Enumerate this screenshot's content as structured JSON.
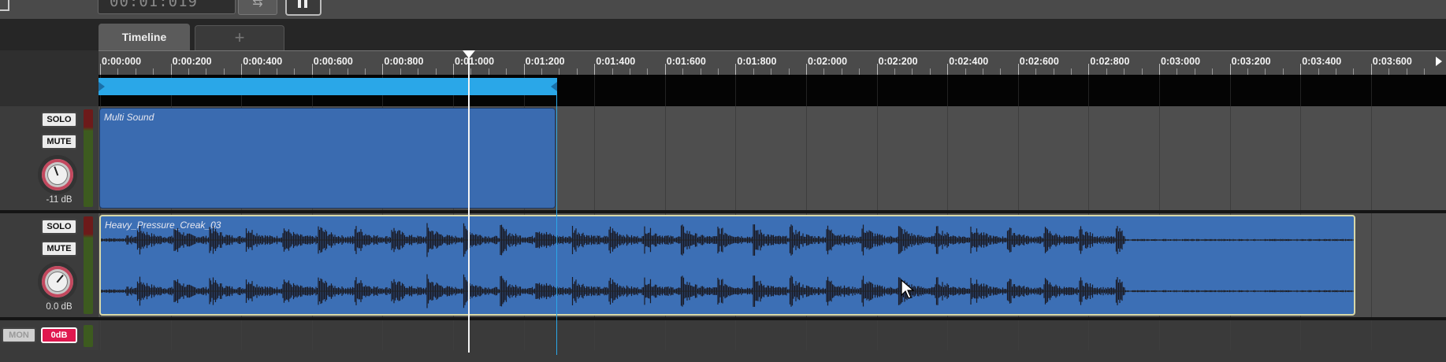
{
  "transport": {
    "time_display": "00:01:019",
    "loop_icon": "loop-icon",
    "pause_icon": "pause-icon"
  },
  "tabs": [
    {
      "label": "Timeline",
      "active": true
    },
    {
      "label": "+",
      "active": false
    }
  ],
  "ruler": {
    "labels": [
      "0:00:000",
      "0:00:200",
      "0:00:400",
      "0:00:600",
      "0:00:800",
      "0:01:000",
      "0:01:200",
      "0:01:400",
      "0:01:600",
      "0:01:800",
      "0:02:000",
      "0:02:200",
      "0:02:400",
      "0:02:600",
      "0:02:800",
      "0:03:000",
      "0:03:200",
      "0:03:400",
      "0:03:600"
    ]
  },
  "tracks": [
    {
      "solo_label": "SOLO",
      "mute_label": "MUTE",
      "volume": "-11 dB",
      "clip": {
        "name": "Multi Sound"
      }
    },
    {
      "solo_label": "SOLO",
      "mute_label": "MUTE",
      "volume": "0.0 dB",
      "clip": {
        "name": "Heavy_Pressure_Creak_03"
      }
    }
  ],
  "master": {
    "mon_label": "MON",
    "db_label": "0dB"
  },
  "colors": {
    "accent_blue": "#2aa7e8",
    "clip_blue": "#3c6fb5",
    "mute_red": "#e0184f",
    "playhead": "#f4f4f4"
  }
}
